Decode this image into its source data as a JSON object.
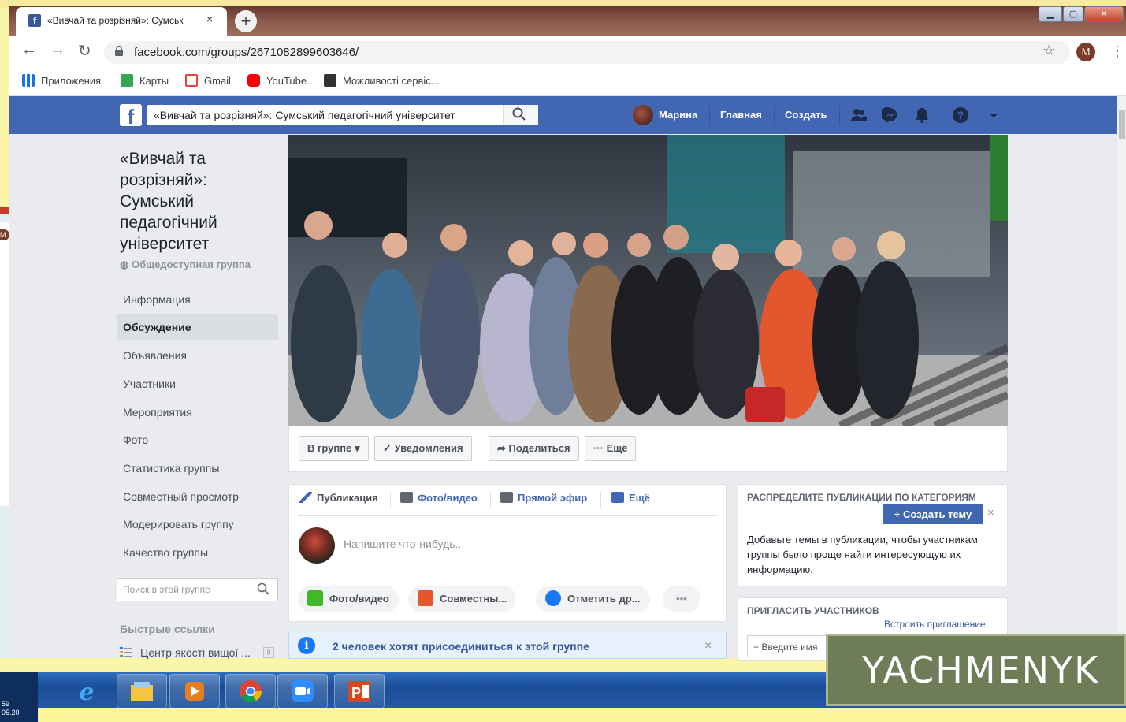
{
  "browser": {
    "tab_title": "«Вивчай та розрізняй»: Сумськ",
    "tab_close": "×",
    "new_tab": "+",
    "url": "facebook.com/groups/2671082899603646/",
    "profile_initial": "M",
    "bookmarks": [
      {
        "label": "Приложения",
        "color": "#1a73e8"
      },
      {
        "label": "Карты",
        "color": "#34a853"
      },
      {
        "label": "Gmail",
        "color": "#ea4335"
      },
      {
        "label": "YouTube",
        "color": "#ff0000"
      },
      {
        "label": "Можливості сервіс...",
        "color": "#333333"
      }
    ]
  },
  "fb_header": {
    "search_value": "«Вивчай та розрізняй»: Сумський педагогічний університет",
    "user_name": "Марина",
    "home": "Главная",
    "create": "Создать"
  },
  "group": {
    "title": "«Вивчай та розрізняй»: Сумський педагогічний університет",
    "type": "Общедоступная группа",
    "nav": [
      {
        "label": "Информация",
        "active": false
      },
      {
        "label": "Обсуждение",
        "active": true
      },
      {
        "label": "Объявления",
        "active": false
      },
      {
        "label": "Участники",
        "active": false
      },
      {
        "label": "Мероприятия",
        "active": false
      },
      {
        "label": "Фото",
        "active": false
      },
      {
        "label": "Статистика группы",
        "active": false
      },
      {
        "label": "Совместный просмотр",
        "active": false
      },
      {
        "label": "Модерировать группу",
        "active": false
      },
      {
        "label": "Качество группы",
        "active": false
      }
    ],
    "search_placeholder": "Поиск в этой группе",
    "quick_links_title": "Быстрые ссылки",
    "quick_link": "Центр якості вищої ...",
    "quick_link_badge": "9"
  },
  "cover_actions": {
    "in_group": "В группе ▾",
    "notifications": "✓ Уведомления",
    "share": "➦ Поделиться",
    "more": "··· Ещё"
  },
  "composer": {
    "tabs": [
      "Публикация",
      "Фото/видео",
      "Прямой эфир",
      "Ещё"
    ],
    "placeholder": "Напишите что-нибудь...",
    "pills": [
      "Фото/видео",
      "Совместны...",
      "Отметить др...",
      "•••"
    ]
  },
  "join_banner": {
    "icon": "i",
    "text": "2 человек хотят присоединиться к этой группе",
    "close": "×"
  },
  "topics_card": {
    "heading": "РАСПРЕДЕЛИТЕ ПУБЛИКАЦИИ ПО КАТЕГОРИЯМ",
    "button": "+ Создать тему",
    "close": "×",
    "body": "Добавьте темы в публикации, чтобы участникам группы было проще найти интересующую их информацию."
  },
  "invite_card": {
    "heading": "ПРИГЛАСИТЬ УЧАСТНИКОВ",
    "embed_link": "Встроить приглашение",
    "input_placeholder": "+ Введите имя"
  },
  "taskbar": {
    "clock": "59\n05.20",
    "icons": [
      "ie-icon",
      "explorer-icon",
      "media-player-icon",
      "chrome-icon",
      "zoom-icon",
      "powerpoint-icon"
    ]
  },
  "watermark": "YACHMENYK",
  "colors": {
    "fb_blue": "#4267b2",
    "link": "#365899"
  }
}
